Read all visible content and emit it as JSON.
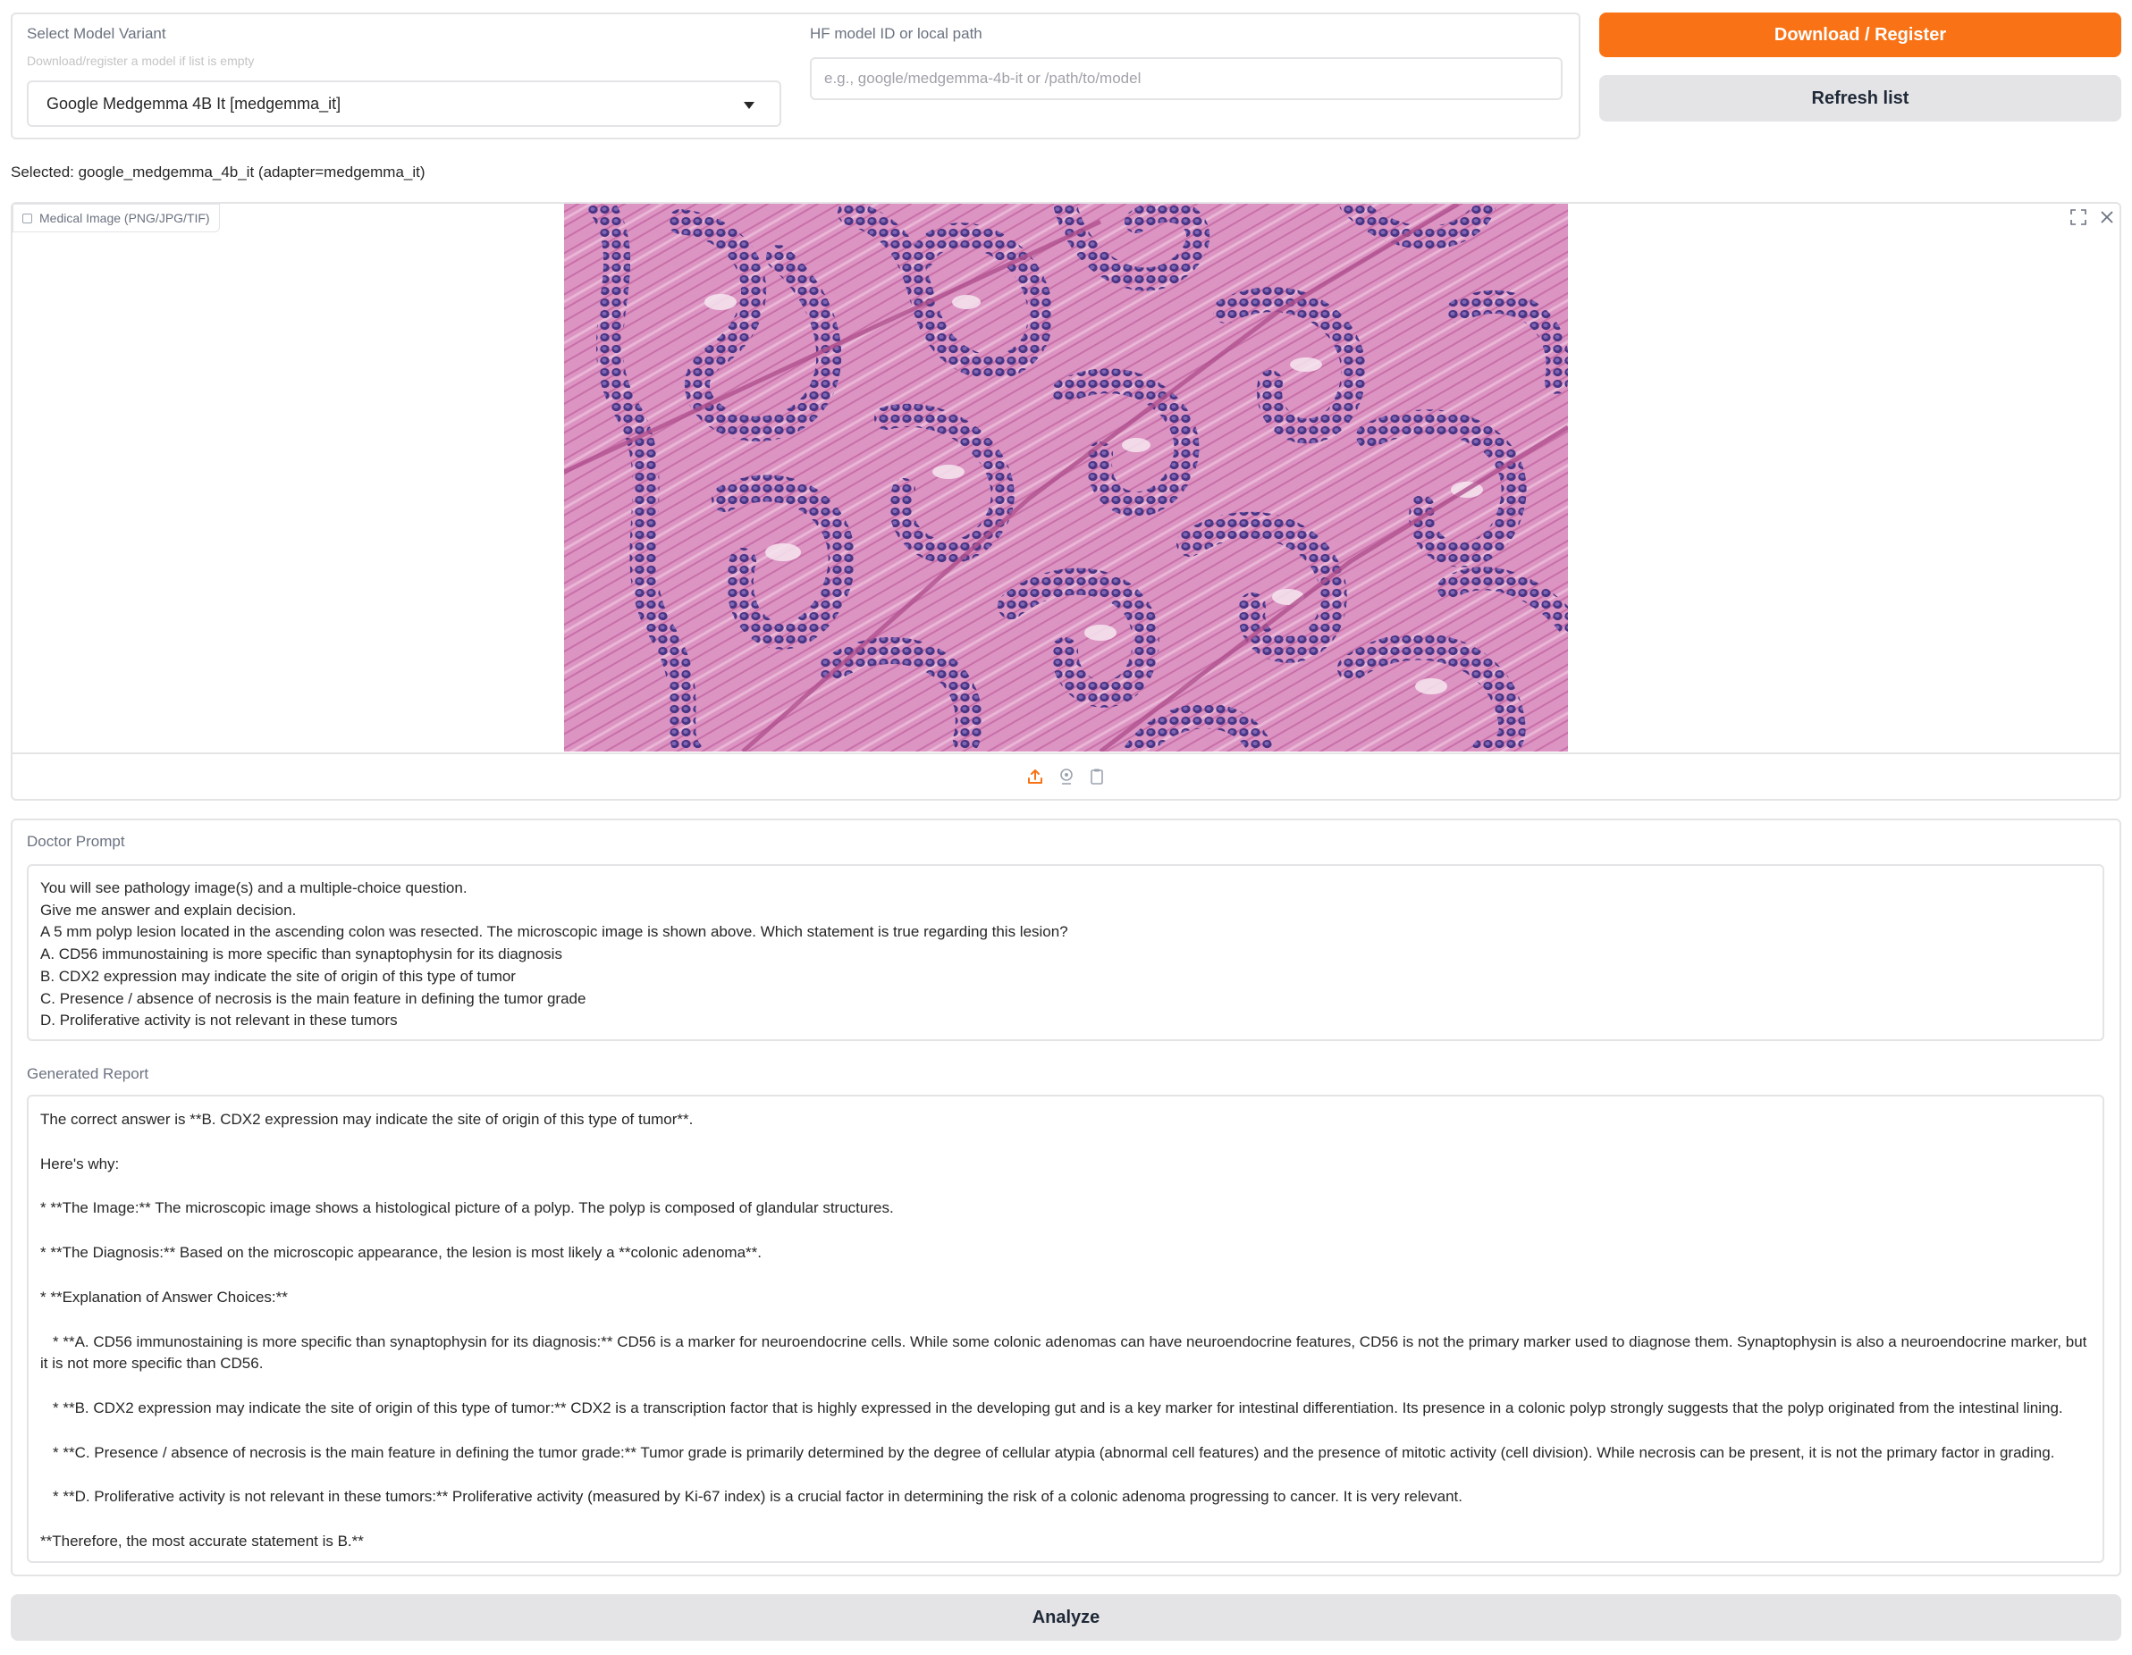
{
  "model_select": {
    "label": "Select Model Variant",
    "info": "Download/register a model if list is empty",
    "selected_value": "Google Medgemma 4B It [medgemma_it]"
  },
  "hf_model": {
    "label": "HF model ID or local path",
    "placeholder": "e.g., google/medgemma-4b-it or /path/to/model"
  },
  "buttons": {
    "download_register": "Download / Register",
    "refresh_list": "Refresh list",
    "analyze": "Analyze"
  },
  "selected_text": "Selected: google_medgemma_4b_it (adapter=medgemma_it)",
  "image_input": {
    "label": "Medical Image (PNG/JPG/TIF)",
    "toolbar_icons": [
      "upload-icon",
      "webcam-icon",
      "clipboard-icon"
    ],
    "corner_icons": [
      "fullscreen-icon",
      "close-icon"
    ]
  },
  "doctor_prompt": {
    "label": "Doctor Prompt",
    "lines": [
      "You will see pathology image(s) and a multiple-choice question.",
      "Give me answer and explain decision.",
      "A 5 mm polyp lesion located in the ascending colon was resected. The microscopic image is shown above. Which statement is true regarding this lesion?",
      "A. CD56 immunostaining is more specific than synaptophysin for its diagnosis",
      "B. CDX2 expression may indicate the site of origin of this type of tumor",
      "C. Presence / absence of necrosis is the main feature in defining the tumor grade",
      "D. Proliferative activity is not relevant in these tumors"
    ]
  },
  "generated_report": {
    "label": "Generated Report",
    "paragraphs": [
      "The correct answer is **B. CDX2 expression may indicate the site of origin of this type of tumor**.",
      "Here's why:",
      "*   **The Image:** The microscopic image shows a histological picture of a polyp. The polyp is composed of glandular structures.",
      "*   **The Diagnosis:** Based on the microscopic appearance, the lesion is most likely a **colonic adenoma**.",
      "*   **Explanation of Answer Choices:**",
      "*   **A. CD56 immunostaining is more specific than synaptophysin for its diagnosis:** CD56 is a marker for neuroendocrine cells. While some colonic adenomas can have neuroendocrine features, CD56 is not the primary marker used to diagnose them. Synaptophysin is also a neuroendocrine marker, but it is not more specific than CD56.",
      "*   **B. CDX2 expression may indicate the site of origin of this type of tumor:** CDX2 is a transcription factor that is highly expressed in the developing gut and is a key marker for intestinal differentiation. Its presence in a colonic polyp strongly suggests that the polyp originated from the intestinal lining.",
      "*   **C. Presence / absence of necrosis is the main feature in defining the tumor grade:** Tumor grade is primarily determined by the degree of cellular atypia (abnormal cell features) and the presence of mitotic activity (cell division). While necrosis can be present, it is not the primary factor in grading.",
      "*   **D. Proliferative activity is not relevant in these tumors:** Proliferative activity (measured by Ki-67 index) is a crucial factor in determining the risk of a colonic adenoma progressing to cancer. It is very relevant.",
      "**Therefore, the most accurate statement is B.**"
    ]
  },
  "colors": {
    "primary_button": "#f97316",
    "secondary_button": "#e4e4e7",
    "border": "#e4e4e7",
    "upload_icon": "#f97316"
  }
}
